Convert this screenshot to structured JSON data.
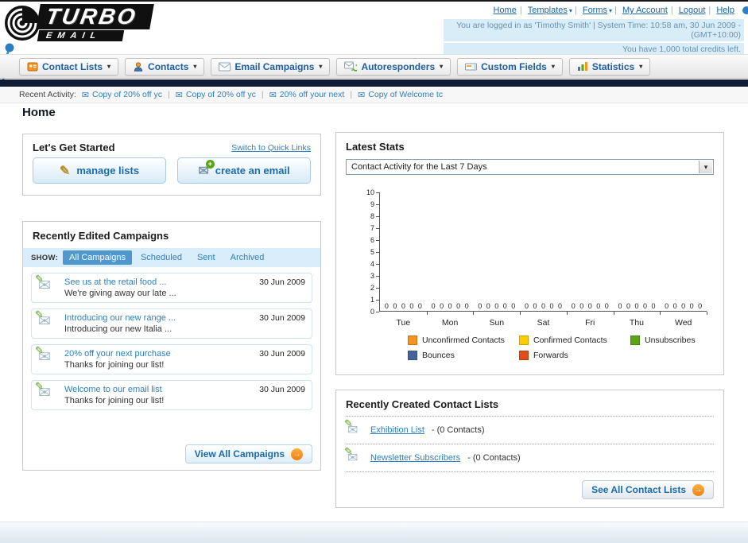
{
  "header": {
    "logo": {
      "title": "TURBO",
      "subtitle": "EMAIL"
    },
    "links": [
      {
        "label": "Home"
      },
      {
        "label": "Templates"
      },
      {
        "label": "Forms"
      },
      {
        "label": "My Account"
      },
      {
        "label": "Logout"
      },
      {
        "label": "Help"
      }
    ],
    "login_info": "You are logged in as 'Timothy Smith' | System Time: 10:58 am, 30 Jun 2009 - (GMT+10:00)",
    "credits_info": "You have 1,000 total credits left."
  },
  "nav": {
    "tabs": [
      {
        "label": "Contact Lists"
      },
      {
        "label": "Contacts"
      },
      {
        "label": "Email Campaigns"
      },
      {
        "label": "Autoresponders"
      },
      {
        "label": "Custom Fields"
      },
      {
        "label": "Statistics"
      }
    ]
  },
  "recent_activity": {
    "label": "Recent Activity:",
    "items": [
      "Copy of 20% off yc",
      "Copy of 20% off yc",
      "20% off your next",
      "Copy of Welcome tc"
    ]
  },
  "page_title": "Home",
  "get_started": {
    "title": "Let's Get Started",
    "switch_link": "Switch to Quick Links",
    "buttons": [
      {
        "label": "manage lists"
      },
      {
        "label": "create an email"
      }
    ]
  },
  "campaigns": {
    "title": "Recently Edited Campaigns",
    "show_label": "SHOW:",
    "tabs": [
      "All Campaigns",
      "Scheduled",
      "Sent",
      "Archived"
    ],
    "selected_tab": "All Campaigns",
    "items": [
      {
        "title": "See us at the retail food ...",
        "subtitle": "We're giving away our late ...",
        "date": "30 Jun 2009"
      },
      {
        "title": "Introducing our new range ...",
        "subtitle": "Introducing our new Italia ...",
        "date": "30 Jun 2009"
      },
      {
        "title": "20% off your next purchase",
        "subtitle": "Thanks for joining our list!",
        "date": "30 Jun 2009"
      },
      {
        "title": "Welcome to our email list",
        "subtitle": "Thanks for joining our list!",
        "date": "30 Jun 2009"
      }
    ],
    "view_all_label": "View All Campaigns"
  },
  "stats": {
    "title": "Latest Stats",
    "dropdown_value": "Contact Activity for the Last 7 Days",
    "chart_data": {
      "type": "bar",
      "title": "Contact Activity for the Last 7 Days",
      "categories": [
        "Tue",
        "Mon",
        "Sun",
        "Sat",
        "Fri",
        "Thu",
        "Wed"
      ],
      "series": [
        {
          "name": "Unconfirmed Contacts",
          "color": "#f7941e",
          "values": [
            0,
            0,
            0,
            0,
            0,
            0,
            0
          ]
        },
        {
          "name": "Confirmed Contacts",
          "color": "#ffcb05",
          "values": [
            0,
            0,
            0,
            0,
            0,
            0,
            0
          ]
        },
        {
          "name": "Unsubscribes",
          "color": "#5ca516",
          "values": [
            0,
            0,
            0,
            0,
            0,
            0,
            0
          ]
        },
        {
          "name": "Bounces",
          "color": "#44639c",
          "values": [
            0,
            0,
            0,
            0,
            0,
            0,
            0
          ]
        },
        {
          "name": "Forwards",
          "color": "#e04e1c",
          "values": [
            0,
            0,
            0,
            0,
            0,
            0,
            0
          ]
        }
      ],
      "ylim": [
        0,
        10
      ],
      "yticks": [
        0,
        1,
        2,
        3,
        4,
        5,
        6,
        7,
        8,
        9,
        10
      ],
      "grid": false,
      "legend_position": "bottom"
    }
  },
  "contact_lists": {
    "title": "Recently Created Contact Lists",
    "items": [
      {
        "name": "Exhibition List",
        "detail": "- (0 Contacts)"
      },
      {
        "name": "Newsletter Subscribers",
        "detail": "- (0 Contacts)"
      }
    ],
    "see_all_label": "See All Contact Lists"
  }
}
